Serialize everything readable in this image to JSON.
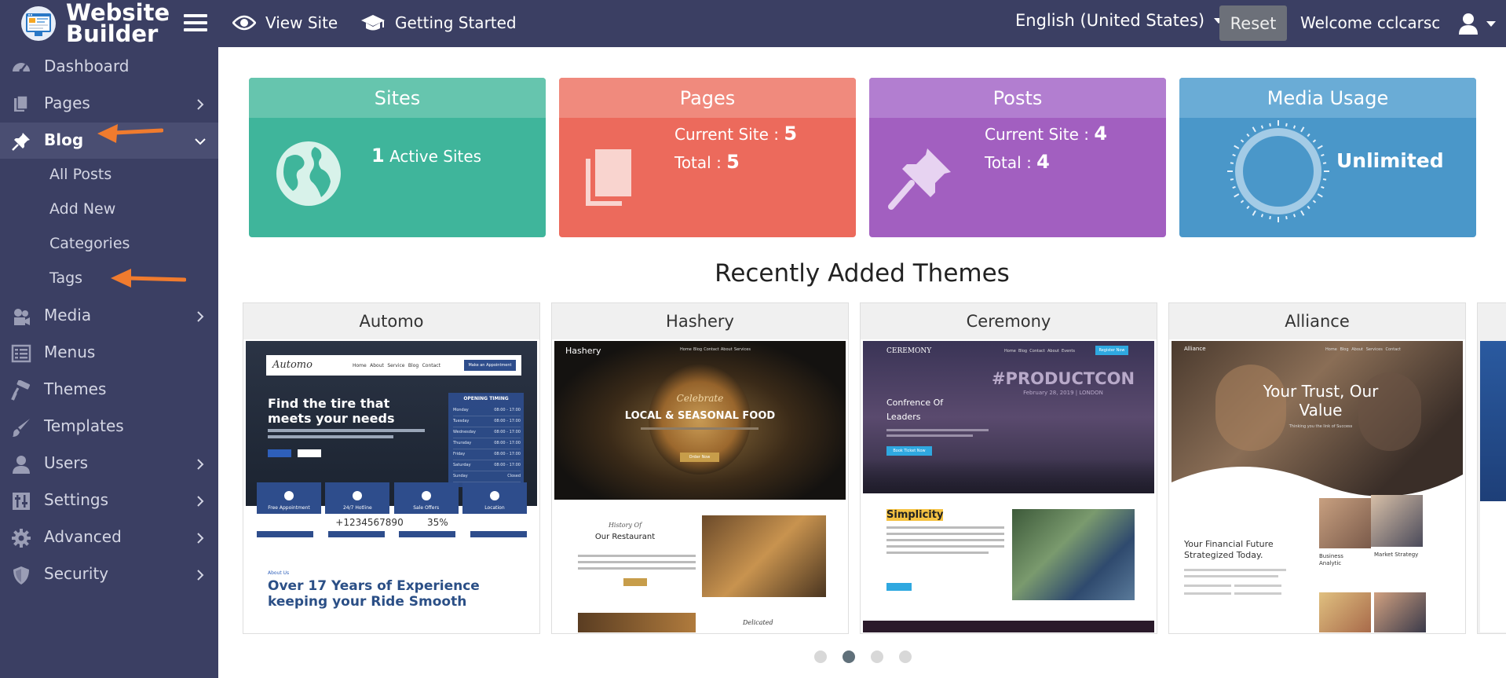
{
  "app": {
    "title_line1": "Website",
    "title_line2": "Builder"
  },
  "topbar": {
    "view_site": "View Site",
    "getting_started": "Getting Started",
    "language": "English (United States)",
    "reset": "Reset",
    "welcome": "Welcome cclcarsc"
  },
  "sidebar": {
    "dashboard": "Dashboard",
    "pages": "Pages",
    "blog": "Blog",
    "blog_sub": {
      "all_posts": "All Posts",
      "add_new": "Add New",
      "categories": "Categories",
      "tags": "Tags"
    },
    "media": "Media",
    "menus": "Menus",
    "themes": "Themes",
    "templates": "Templates",
    "users": "Users",
    "settings": "Settings",
    "advanced": "Advanced",
    "security": "Security"
  },
  "cards": {
    "sites": {
      "title": "Sites",
      "count": "1",
      "text": "Active Sites"
    },
    "pages": {
      "title": "Pages",
      "current_label": "Current Site :",
      "current": "5",
      "total_label": "Total :",
      "total": "5"
    },
    "posts": {
      "title": "Posts",
      "current_label": "Current Site :",
      "current": "4",
      "total_label": "Total :",
      "total": "4"
    },
    "media": {
      "title": "Media Usage",
      "value": "Unlimited"
    }
  },
  "themes": {
    "heading": "Recently Added Themes",
    "items": [
      {
        "name": "Automo",
        "preview": {
          "brand": "Automo",
          "nav": [
            "Home",
            "About",
            "Service",
            "Blog",
            "Contact"
          ],
          "nav_button": "Make an Appointment",
          "headline": "Find the tire that meets your needs",
          "hours_title": "OPENING TIMING",
          "hours_days": [
            "Monday",
            "Tuesday",
            "Wednesday",
            "Thursday",
            "Friday",
            "Saturday",
            "Sunday"
          ],
          "hours_times": [
            "08:00 - 17:00",
            "08:00 - 17:00",
            "08:00 - 17:00",
            "08:00 - 17:00",
            "08:00 - 17:00",
            "08:00 - 17:00",
            "Closed"
          ],
          "features": [
            "Free Appointment",
            "24/7 Hotline",
            "Sale Offers",
            "Location"
          ],
          "phone": "+1234567890",
          "percent": "35%",
          "about_tag": "About Us",
          "heading2": "Over 17 Years of Experience keeping your Ride Smooth"
        }
      },
      {
        "name": "Hashery",
        "preview": {
          "brand": "Hashery",
          "nav": [
            "Home",
            "Blog",
            "Contact",
            "About",
            "Services"
          ],
          "script": "Celebrate",
          "headline": "LOCAL & SEASONAL FOOD",
          "button": "Order Now",
          "history": "History Of",
          "section": "Our Restaurant",
          "footer_script": "Delicated"
        }
      },
      {
        "name": "Ceremony",
        "preview": {
          "brand": "CEREMONY",
          "nav": [
            "Home",
            "Blog",
            "Contact",
            "About",
            "Events"
          ],
          "nav_button": "Register Now",
          "event_title": "#PRODUCTCON",
          "event_date": "February 28, 2019 | LONDON",
          "headline": "Confrence Of Leaders",
          "button": "Book Ticket Now",
          "section": "Simplicity"
        }
      },
      {
        "name": "Alliance",
        "preview": {
          "brand": "Alliance",
          "nav": [
            "Home",
            "Blog",
            "About",
            "Services",
            "Contact"
          ],
          "headline": "Your Trust, Our Value",
          "tagline": "Thinking you the link of Success",
          "heading2": "Your Financial Future Strategized Today.",
          "tiles": [
            "Business Analytic",
            "Market Strategy"
          ]
        }
      }
    ]
  },
  "carousel": {
    "active_index": 1,
    "count": 4
  },
  "colors": {
    "topbar_bg": "#3b3f63",
    "sites": "#3fb59b",
    "pages": "#ec6a5c",
    "posts": "#a25fc0",
    "media": "#4a97c9",
    "annotation_arrow": "#f07b2e"
  }
}
